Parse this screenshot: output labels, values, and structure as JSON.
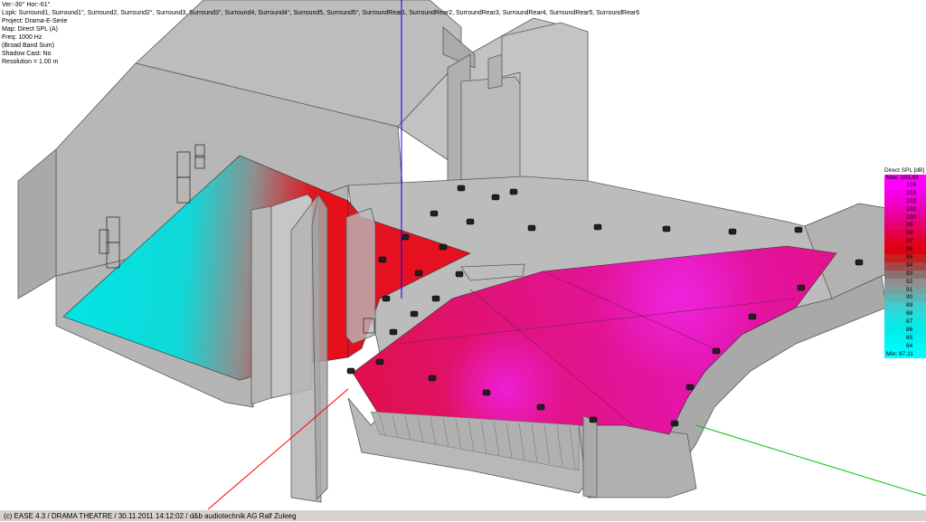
{
  "info": {
    "lines": [
      "Ver:-30°  Hor:-61°",
      "Lspk: Surround1, Surround1°, Surround2, Surround2°, Surround3, Surround3°, Surround4, Surround4°, Surround5, Surround5°, SurroundRear1, SurroundRear2, SurroundRear3, SurroundRear4, SurroundRear5, SurroundRear6",
      "Project: Drama-E-Serie",
      "Map: Direct SPL (A)",
      "Freq: 1000 Hz",
      "(Broad Band Sum)",
      "Shadow Cast: No",
      "Resolution =  1.00 m"
    ]
  },
  "legend": {
    "title": "Direct SPL [dB]",
    "max_label": "Max:  103,83",
    "min_label": "Min:  87,11",
    "entries": [
      {
        "value": "104",
        "color": "#ff00ff"
      },
      {
        "value": "103",
        "color": "#f500e6"
      },
      {
        "value": "102",
        "color": "#ef00cc"
      },
      {
        "value": "101",
        "color": "#eb00b0"
      },
      {
        "value": "100",
        "color": "#e80090"
      },
      {
        "value": "99",
        "color": "#e5006c"
      },
      {
        "value": "98",
        "color": "#e40048"
      },
      {
        "value": "97",
        "color": "#e30024"
      },
      {
        "value": "96",
        "color": "#e00010"
      },
      {
        "value": "95",
        "color": "#c81e1e"
      },
      {
        "value": "94",
        "color": "#a04848"
      },
      {
        "value": "93",
        "color": "#8a7070"
      },
      {
        "value": "92",
        "color": "#8f8f8f"
      },
      {
        "value": "91",
        "color": "#7aa0a0"
      },
      {
        "value": "90",
        "color": "#5fb5b5"
      },
      {
        "value": "89",
        "color": "#3fcdcd"
      },
      {
        "value": "88",
        "color": "#24dcdc"
      },
      {
        "value": "87",
        "color": "#10e6e6"
      },
      {
        "value": "86",
        "color": "#00ecec"
      },
      {
        "value": "85",
        "color": "#00f2f2"
      },
      {
        "value": "84",
        "color": "#00f8f8"
      }
    ],
    "max_color": "#ff00ff",
    "min_color": "#00ffff"
  },
  "status": {
    "text": "(c) EASE 4.3  / DRAMA THEATRE  / 30.11.2011 14:12:02 / d&b audiotechnik AG Ralf Zuleeg"
  },
  "colors": {
    "wall": "#b9b9b9",
    "wall_dark": "#a8a8a8",
    "edge": "#5a5a5a",
    "cyan_zone": "#00e6e6",
    "red_zone": "#e5101a",
    "magenta_zone": "#e2138c",
    "axis_z": "#0000ff",
    "axis_x": "#ff0000",
    "axis_y": "#00c000"
  }
}
